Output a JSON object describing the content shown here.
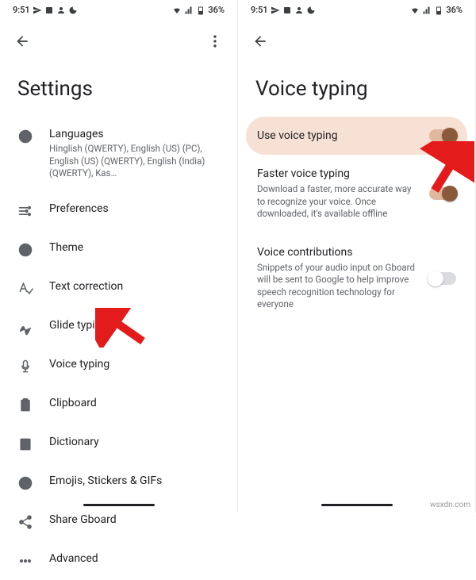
{
  "status": {
    "time": "9:51",
    "battery": "36%"
  },
  "left": {
    "title": "Settings",
    "items": [
      {
        "label": "Languages",
        "sub": "Hinglish (QWERTY), English (US) (PC), English (US) (QWERTY), English (India) (QWERTY), Kas…"
      },
      {
        "label": "Preferences",
        "sub": ""
      },
      {
        "label": "Theme",
        "sub": ""
      },
      {
        "label": "Text correction",
        "sub": ""
      },
      {
        "label": "Glide typing",
        "sub": ""
      },
      {
        "label": "Voice typing",
        "sub": ""
      },
      {
        "label": "Clipboard",
        "sub": ""
      },
      {
        "label": "Dictionary",
        "sub": ""
      },
      {
        "label": "Emojis, Stickers & GIFs",
        "sub": ""
      },
      {
        "label": "Share Gboard",
        "sub": ""
      },
      {
        "label": "Advanced",
        "sub": ""
      }
    ]
  },
  "right": {
    "title": "Voice typing",
    "items": [
      {
        "label": "Use voice typing",
        "sub": "",
        "on": true,
        "highlight": true
      },
      {
        "label": "Faster voice typing",
        "sub": "Download a faster, more accurate way to recognize your voice. Once downloaded, it's available offline",
        "on": true,
        "highlight": false
      },
      {
        "label": "Voice contributions",
        "sub": "Snippets of your audio input on Gboard will be sent to Google to help improve speech recognition technology for everyone",
        "on": false,
        "highlight": false
      }
    ]
  },
  "watermark": "wsxdn.com"
}
